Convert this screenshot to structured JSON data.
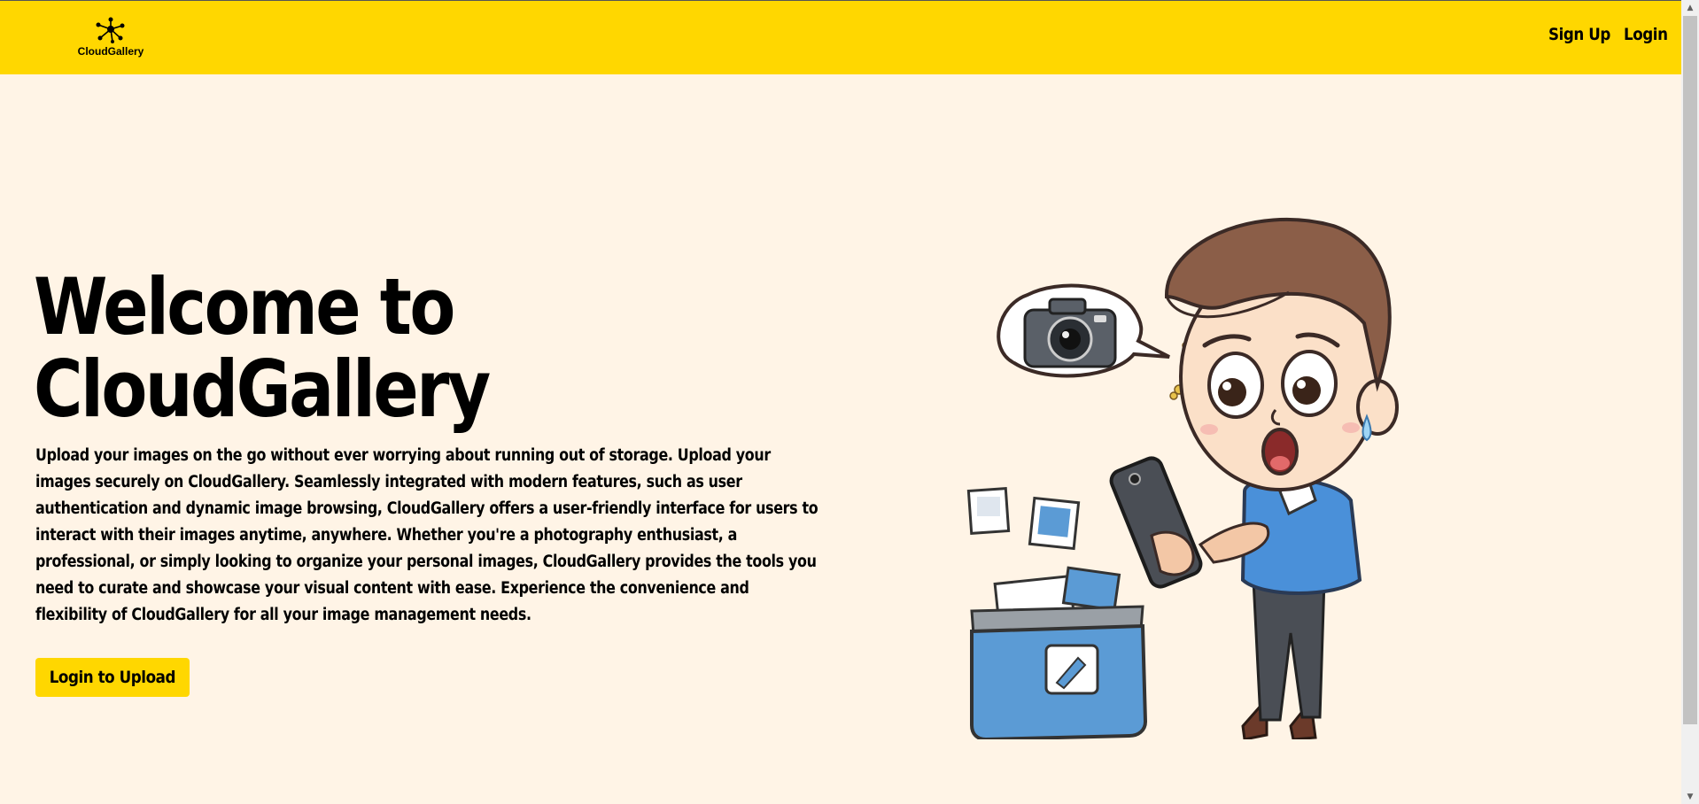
{
  "brand": {
    "name": "CloudGallery"
  },
  "nav": {
    "signup": "Sign Up",
    "login": "Login"
  },
  "hero": {
    "title_line1": "Welcome to",
    "title_line2": "CloudGallery",
    "body_pre": "Upload your images on the go without ever worrying about running out of storage. Upload your images securely on ",
    "body_brand": "CloudGallery",
    "body_post": ". Seamlessly integrated with modern features, such as user authentication and dynamic image browsing, CloudGallery offers a user-friendly interface for users to interact with their images anytime, anywhere. Whether you're a photography enthusiast, a professional, or simply looking to organize your personal images, CloudGallery provides the tools you need to curate and showcase your visual content with ease. Experience the convenience and flexibility of CloudGallery for all your image management needs.",
    "cta": "Login to Upload"
  },
  "colors": {
    "accent": "#ffd700",
    "background": "#fff4e6"
  },
  "icons": {
    "logo": "network-nodes-icon",
    "illustration": "confused-man-with-phone-illustration"
  }
}
